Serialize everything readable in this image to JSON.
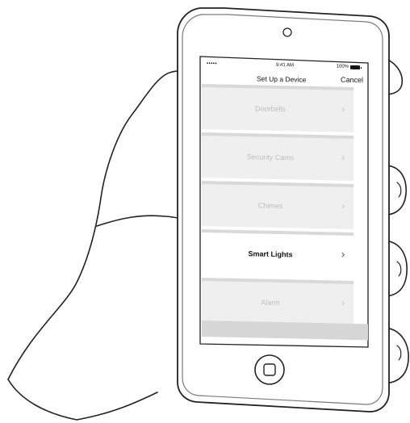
{
  "status_bar": {
    "signal": "•••••",
    "time": "9:41 AM",
    "battery_text": "100%"
  },
  "nav": {
    "title": "Set Up a Device",
    "cancel_label": "Cancel"
  },
  "list": {
    "items": [
      {
        "label": "Doorbells"
      },
      {
        "label": "Security Cams"
      },
      {
        "label": "Chimes"
      },
      {
        "label": "Smart Lights",
        "selected": true
      },
      {
        "label": "Alarm"
      }
    ]
  },
  "icons": {
    "chevron": "chevron-right-icon",
    "battery": "battery-icon"
  }
}
